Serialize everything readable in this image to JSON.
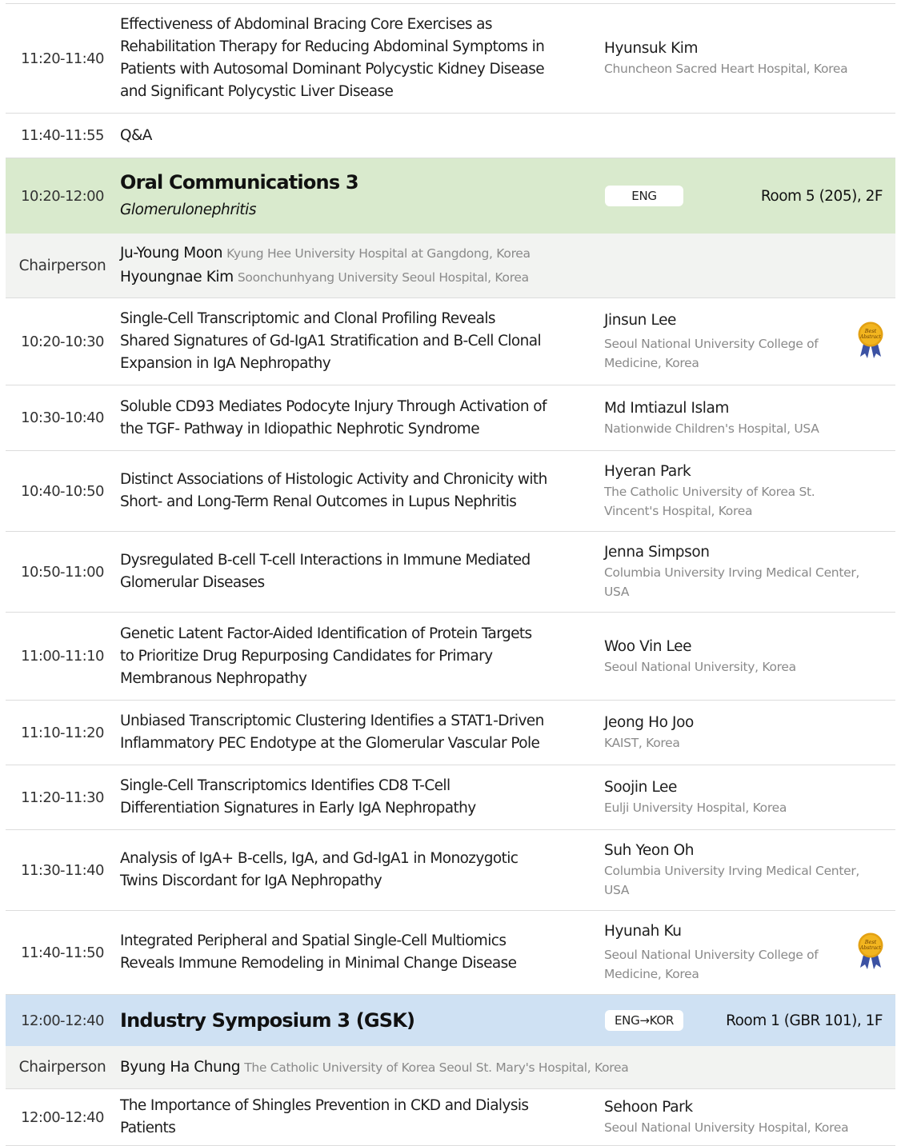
{
  "talks": [
    {
      "time": "11:20-11:40",
      "title": [
        "Effectiveness of Abdominal Bracing Core Exercises as",
        "Rehabilitation Therapy for Reducing Abdominal Symptoms in",
        "Patients with Autosomal Dominant Polycystic Kidney Disease",
        "and Significant Polycystic Liver Disease"
      ],
      "speaker": "Hyunsuk Kim",
      "affiliation": [
        "Chuncheon Sacred Heart Hospital, Korea"
      ]
    },
    {
      "time": "11:40-11:55",
      "title": [
        "Q&A"
      ],
      "speaker": "",
      "affiliation": []
    }
  ],
  "section1": {
    "time": "10:20-12:00",
    "title": "Oral Communications 3",
    "subtitle": "Glomerulonephritis",
    "lang": "ENG",
    "room": "Room 5 (205), 2F",
    "chair_label": "Chairperson",
    "chairs": [
      {
        "name": "Ju-Young Moon",
        "affiliation": "Kyung Hee University Hospital at Gangdong, Korea"
      },
      {
        "name": "Hyoungnae Kim",
        "affiliation": "Soonchunhyang University Seoul Hospital, Korea"
      }
    ],
    "talks": [
      {
        "time": "10:20-10:30",
        "title": [
          "Single-Cell Transcriptomic and Clonal Profiling Reveals",
          "Shared Signatures of Gd-IgA1 Stratification and B-Cell Clonal",
          "Expansion in IgA Nephropathy"
        ],
        "speaker": "Jinsun Lee",
        "affiliation": [
          "Seoul National University College of",
          "Medicine, Korea"
        ],
        "award": true
      },
      {
        "time": "10:30-10:40",
        "title": [
          "Soluble CD93 Mediates Podocyte Injury Through Activation of",
          "the TGF- Pathway in Idiopathic Nephrotic Syndrome"
        ],
        "speaker": "Md Imtiazul Islam",
        "affiliation": [
          "Nationwide Children's Hospital, USA"
        ]
      },
      {
        "time": "10:40-10:50",
        "title": [
          "Distinct Associations of Histologic Activity and Chronicity with",
          "Short- and Long-Term Renal Outcomes in Lupus Nephritis"
        ],
        "speaker": "Hyeran Park",
        "affiliation": [
          "The Catholic University of Korea St.",
          "Vincent's Hospital, Korea"
        ]
      },
      {
        "time": "10:50-11:00",
        "title": [
          "Dysregulated B-cell T-cell Interactions in Immune Mediated",
          "Glomerular Diseases"
        ],
        "speaker": "Jenna Simpson",
        "affiliation": [
          "Columbia University Irving Medical Center,",
          "USA"
        ]
      },
      {
        "time": "11:00-11:10",
        "title": [
          "Genetic Latent Factor-Aided Identification of Protein Targets",
          "to Prioritize Drug Repurposing Candidates for Primary",
          "Membranous Nephropathy"
        ],
        "speaker": "Woo Vin Lee",
        "affiliation": [
          "Seoul National University, Korea"
        ]
      },
      {
        "time": "11:10-11:20",
        "title": [
          "Unbiased Transcriptomic Clustering Identifies a STAT1-Driven",
          "Inflammatory PEC Endotype at the Glomerular Vascular Pole"
        ],
        "speaker": "Jeong Ho Joo",
        "affiliation": [
          "KAIST, Korea"
        ]
      },
      {
        "time": "11:20-11:30",
        "title": [
          "Single-Cell Transcriptomics Identifies CD8 T-Cell",
          "Differentiation Signatures in Early IgA Nephropathy"
        ],
        "speaker": "Soojin Lee",
        "affiliation": [
          "Eulji University Hospital, Korea"
        ]
      },
      {
        "time": "11:30-11:40",
        "title": [
          "Analysis of IgA+ B-cells, IgA, and Gd-IgA1 in Monozygotic",
          "Twins Discordant for IgA Nephropathy"
        ],
        "speaker": "Suh Yeon Oh",
        "affiliation": [
          "Columbia University Irving Medical Center,",
          "USA"
        ]
      },
      {
        "time": "11:40-11:50",
        "title": [
          "Integrated Peripheral and Spatial Single-Cell Multiomics",
          "Reveals Immune Remodeling in Minimal Change Disease"
        ],
        "speaker": "Hyunah Ku",
        "affiliation": [
          "Seoul National University College of",
          "Medicine, Korea"
        ],
        "award": true
      }
    ]
  },
  "section2": {
    "time": "12:00-12:40",
    "title": "Industry Symposium 3 (GSK)",
    "lang": "ENG→KOR",
    "room": "Room 1 (GBR 101), 1F",
    "chair_label": "Chairperson",
    "chairs": [
      {
        "name": "Byung Ha Chung",
        "affiliation": "The Catholic University of Korea Seoul St. Mary's Hospital, Korea"
      }
    ],
    "talks": [
      {
        "time": "12:00-12:40",
        "title": [
          "The Importance of Shingles Prevention in CKD and Dialysis",
          "Patients"
        ],
        "speaker": "Sehoon Park",
        "affiliation": [
          "Seoul National University Hospital, Korea"
        ]
      }
    ]
  },
  "award_text": [
    "Best",
    "Abstract"
  ],
  "colors": {
    "section_green": "#d9eacd",
    "section_blue": "#cfe1f3",
    "chair_bg": "#f2f3f1",
    "award_gold": "#f2b51f",
    "award_ribbon": "#3c52a3"
  }
}
